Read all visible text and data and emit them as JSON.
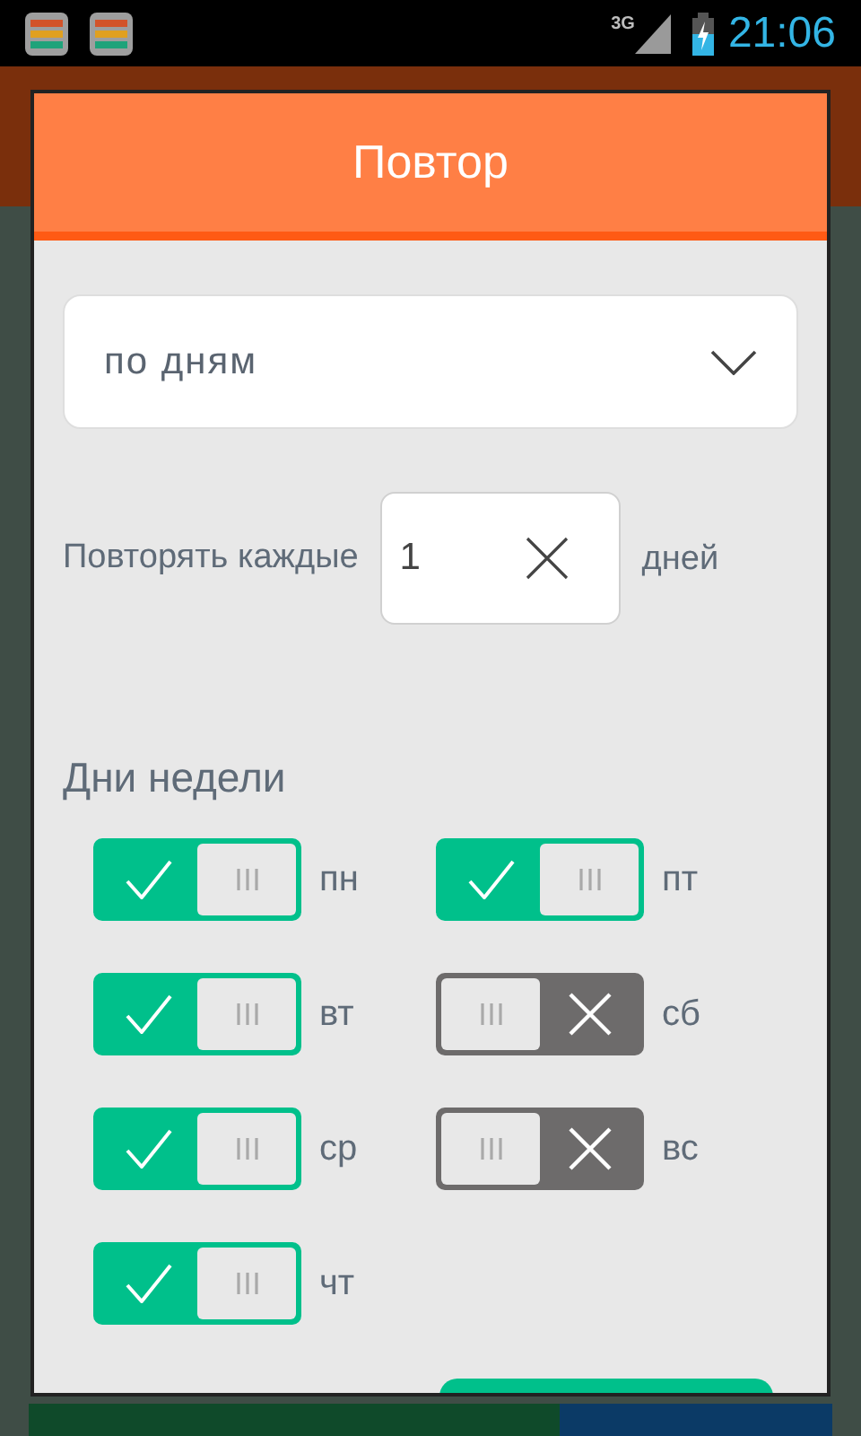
{
  "status_bar": {
    "network": "3G",
    "time": "21:06"
  },
  "dialog": {
    "title": "Повтор",
    "repeat_select": {
      "value": "по дням"
    },
    "interval": {
      "label": "Повторять каждые",
      "value": "1",
      "unit": "дней"
    },
    "weekdays_title": "Дни недели",
    "days": [
      {
        "label": "пн",
        "checked": true
      },
      {
        "label": "вт",
        "checked": true
      },
      {
        "label": "ср",
        "checked": true
      },
      {
        "label": "чт",
        "checked": true
      },
      {
        "label": "пт",
        "checked": true
      },
      {
        "label": "сб",
        "checked": false
      },
      {
        "label": "вс",
        "checked": false
      }
    ]
  },
  "background": {
    "progress": {
      "level": 0.66
    }
  }
}
